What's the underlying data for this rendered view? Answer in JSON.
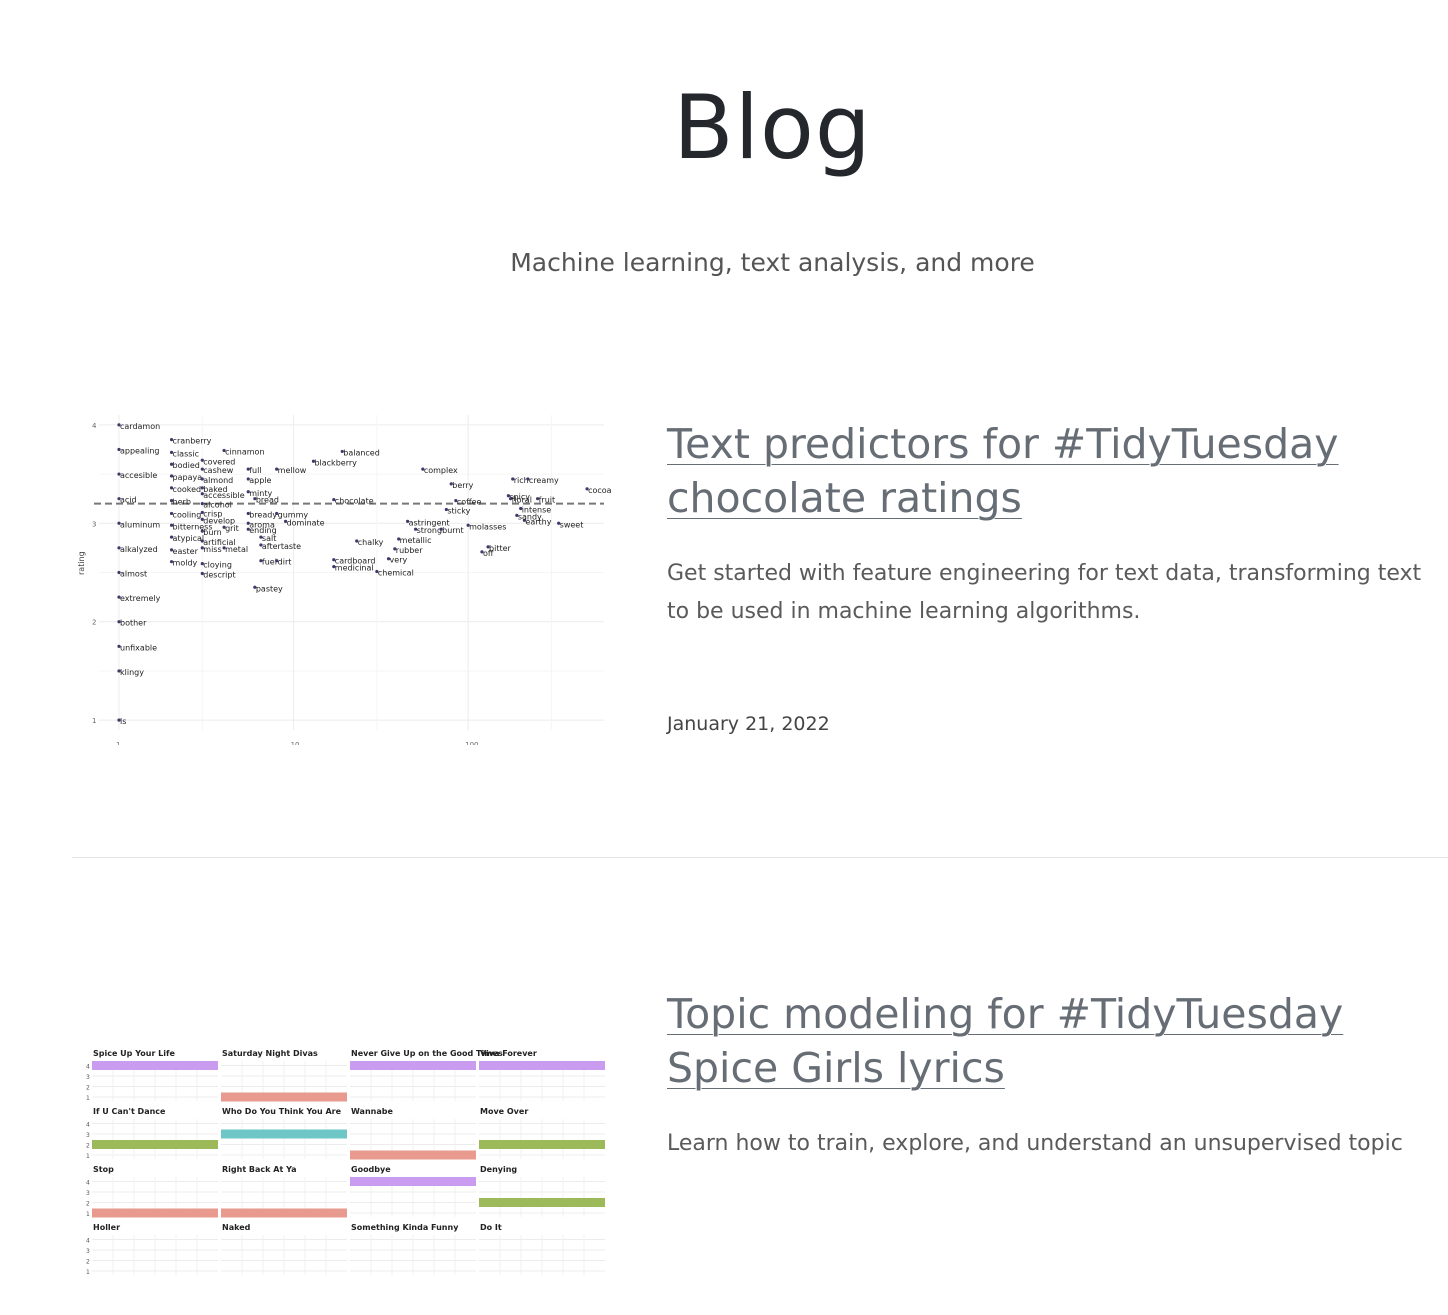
{
  "header": {
    "title": "Blog",
    "subtitle": "Machine learning, text analysis, and more"
  },
  "posts": [
    {
      "title": "Text predictors for #TidyTuesday chocolate ratings",
      "description": "Get started with feature engineering for text data, transforming text to be used in machine learning algorithms.",
      "date": "January 21, 2022",
      "thumbnail": {
        "chart_data": {
          "type": "scatter",
          "xlabel": "n",
          "ylabel": "rating",
          "x_scale": "log",
          "x_ticks": [
            "1",
            "10",
            "100"
          ],
          "y_ticks": [
            "1",
            "2",
            "3",
            "4"
          ],
          "reference_line_y": 3.2,
          "points": [
            {
              "label": "cardamon",
              "x": 1,
              "y": 4.0
            },
            {
              "label": "appealing",
              "x": 1,
              "y": 3.75
            },
            {
              "label": "accesible",
              "x": 1,
              "y": 3.5
            },
            {
              "label": "acid",
              "x": 1,
              "y": 3.25
            },
            {
              "label": "aluminum",
              "x": 1,
              "y": 3.0
            },
            {
              "label": "alkalyzed",
              "x": 1,
              "y": 2.75
            },
            {
              "label": "almost",
              "x": 1,
              "y": 2.5
            },
            {
              "label": "extremely",
              "x": 1,
              "y": 2.25
            },
            {
              "label": "bother",
              "x": 1,
              "y": 2.0
            },
            {
              "label": "unfixable",
              "x": 1,
              "y": 1.75
            },
            {
              "label": "klingy",
              "x": 1,
              "y": 1.5
            },
            {
              "label": "ls",
              "x": 1,
              "y": 1.0
            },
            {
              "label": "cranberry",
              "x": 2,
              "y": 3.85
            },
            {
              "label": "classic",
              "x": 2,
              "y": 3.72
            },
            {
              "label": "bodied",
              "x": 2,
              "y": 3.6
            },
            {
              "label": "papaya",
              "x": 2,
              "y": 3.48
            },
            {
              "label": "cooked",
              "x": 2,
              "y": 3.36
            },
            {
              "label": "herb",
              "x": 2,
              "y": 3.23
            },
            {
              "label": "cooling",
              "x": 2,
              "y": 3.1
            },
            {
              "label": "bitterness",
              "x": 2,
              "y": 2.98
            },
            {
              "label": "atypical",
              "x": 2,
              "y": 2.86
            },
            {
              "label": "easter",
              "x": 2,
              "y": 2.73
            },
            {
              "label": "moldy",
              "x": 2,
              "y": 2.61
            },
            {
              "label": "covered",
              "x": 3,
              "y": 3.64
            },
            {
              "label": "cashew",
              "x": 3,
              "y": 3.55
            },
            {
              "label": "almond",
              "x": 3,
              "y": 3.45
            },
            {
              "label": "baked",
              "x": 3,
              "y": 3.36
            },
            {
              "label": "accessible",
              "x": 3,
              "y": 3.3
            },
            {
              "label": "alcohol",
              "x": 3,
              "y": 3.2
            },
            {
              "label": "crisp",
              "x": 3,
              "y": 3.11
            },
            {
              "label": "develop",
              "x": 3,
              "y": 3.04
            },
            {
              "label": "burn",
              "x": 3,
              "y": 2.92
            },
            {
              "label": "artificial",
              "x": 3,
              "y": 2.82
            },
            {
              "label": "miss",
              "x": 3,
              "y": 2.75
            },
            {
              "label": "cloying",
              "x": 3,
              "y": 2.59
            },
            {
              "label": "descript",
              "x": 3,
              "y": 2.49
            },
            {
              "label": "cinnamon",
              "x": 4,
              "y": 3.74
            },
            {
              "label": "grit",
              "x": 4,
              "y": 2.96
            },
            {
              "label": "metal",
              "x": 4,
              "y": 2.75
            },
            {
              "label": "full",
              "x": 5.5,
              "y": 3.55
            },
            {
              "label": "apple",
              "x": 5.5,
              "y": 3.45
            },
            {
              "label": "minty",
              "x": 5.5,
              "y": 3.32
            },
            {
              "label": "bread",
              "x": 6,
              "y": 3.25
            },
            {
              "label": "bready",
              "x": 5.5,
              "y": 3.1
            },
            {
              "label": "aroma",
              "x": 5.5,
              "y": 3.0
            },
            {
              "label": "ending",
              "x": 5.5,
              "y": 2.94
            },
            {
              "label": "salt",
              "x": 6.5,
              "y": 2.86
            },
            {
              "label": "aftertaste",
              "x": 6.5,
              "y": 2.78
            },
            {
              "label": "fuel",
              "x": 6.5,
              "y": 2.62
            },
            {
              "label": "pastey",
              "x": 6,
              "y": 2.35
            },
            {
              "label": "mellow",
              "x": 8,
              "y": 3.55
            },
            {
              "label": "dirt",
              "x": 8,
              "y": 2.62
            },
            {
              "label": "dominate",
              "x": 9,
              "y": 3.02
            },
            {
              "label": "gummy",
              "x": 8,
              "y": 3.1
            },
            {
              "label": "blackberry",
              "x": 13,
              "y": 3.63
            },
            {
              "label": "balanced",
              "x": 19,
              "y": 3.73
            },
            {
              "label": "rich",
              "x": 180,
              "y": 3.45
            },
            {
              "label": "creamy",
              "x": 220,
              "y": 3.45
            },
            {
              "label": "cocoa",
              "x": 480,
              "y": 3.35
            },
            {
              "label": "fruit",
              "x": 250,
              "y": 3.25
            },
            {
              "label": "sweet",
              "x": 330,
              "y": 3.0
            },
            {
              "label": "molasses",
              "x": 100,
              "y": 2.98
            },
            {
              "label": "complex",
              "x": 55,
              "y": 3.55
            },
            {
              "label": "astringent",
              "x": 45,
              "y": 3.02
            },
            {
              "label": "strong",
              "x": 50,
              "y": 2.94
            },
            {
              "label": "burnt",
              "x": 70,
              "y": 2.94
            },
            {
              "label": "bitter",
              "x": 130,
              "y": 2.76
            },
            {
              "label": "off",
              "x": 120,
              "y": 2.71
            },
            {
              "label": "chemical",
              "x": 30,
              "y": 2.51
            },
            {
              "label": "very",
              "x": 35,
              "y": 2.64
            },
            {
              "label": "rubber",
              "x": 38,
              "y": 2.74
            },
            {
              "label": "metallic",
              "x": 40,
              "y": 2.84
            },
            {
              "label": "chalky",
              "x": 23,
              "y": 2.82
            },
            {
              "label": "cardboard",
              "x": 17,
              "y": 2.63
            },
            {
              "label": "medicinal",
              "x": 17,
              "y": 2.56
            },
            {
              "label": "chocolate",
              "x": 17,
              "y": 3.24
            },
            {
              "label": "intense",
              "x": 200,
              "y": 3.15
            },
            {
              "label": "earthy",
              "x": 210,
              "y": 3.03
            },
            {
              "label": "sandy",
              "x": 190,
              "y": 3.08
            },
            {
              "label": "spicy",
              "x": 170,
              "y": 3.28
            },
            {
              "label": "floral",
              "x": 175,
              "y": 3.25
            },
            {
              "label": "coffee",
              "x": 85,
              "y": 3.23
            },
            {
              "label": "sticky",
              "x": 75,
              "y": 3.14
            },
            {
              "label": "berry",
              "x": 80,
              "y": 3.4
            }
          ]
        }
      }
    },
    {
      "title": "Topic modeling for #TidyTuesday Spice Girls lyrics",
      "description": "Learn how to train, explore, and understand an unsupervised topic",
      "thumbnail": {
        "chart_data": {
          "type": "bar",
          "y_ticks": [
            "1",
            "2",
            "3",
            "4"
          ],
          "panels": [
            {
              "name": "Spice Up Your Life",
              "topic": 4,
              "color": "#c99cf0"
            },
            {
              "name": "Saturday Night Divas",
              "topic": 1,
              "color": "#e99a8e"
            },
            {
              "name": "Never Give Up on the Good Times",
              "topic": 4,
              "color": "#c99cf0"
            },
            {
              "name": "Viva Forever",
              "topic": 4,
              "color": "#c99cf0"
            },
            {
              "name": "If U Can't Dance",
              "topic": 2,
              "color": "#9cba5a"
            },
            {
              "name": "Who Do You Think You Are",
              "topic": 3,
              "color": "#6fc6c7"
            },
            {
              "name": "Wannabe",
              "topic": 1,
              "color": "#e99a8e"
            },
            {
              "name": "Move Over",
              "topic": 2,
              "color": "#9cba5a"
            },
            {
              "name": "Stop",
              "topic": 1,
              "color": "#e99a8e"
            },
            {
              "name": "Right Back At Ya",
              "topic": 1,
              "color": "#e99a8e"
            },
            {
              "name": "Goodbye",
              "topic": 4,
              "color": "#c99cf0"
            },
            {
              "name": "Denying",
              "topic": 2,
              "color": "#9cba5a"
            },
            {
              "name": "Holler",
              "topic": null,
              "color": "#e99a8e"
            },
            {
              "name": "Naked",
              "topic": null,
              "color": "#e99a8e"
            },
            {
              "name": "Something Kinda Funny",
              "topic": null,
              "color": "#e99a8e"
            },
            {
              "name": "Do It",
              "topic": null,
              "color": "#e99a8e"
            }
          ]
        }
      }
    }
  ]
}
